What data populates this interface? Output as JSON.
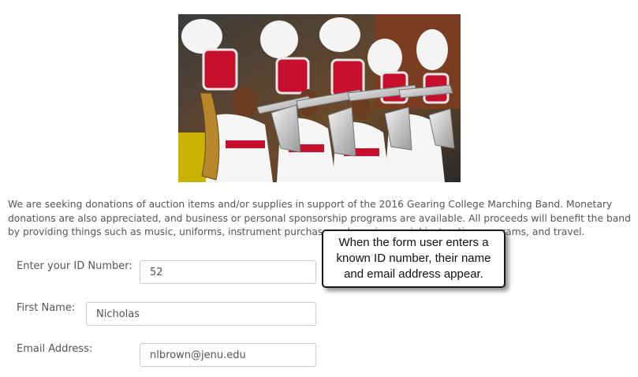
{
  "image": {
    "alt": "Marching band members in red and white uniforms with plumed hats playing trumpets"
  },
  "intro_text": "We are seeking donations of auction items and/or supplies in support of the 2016 Gearing College Marching Band. Monetary donations are also appreciated, and business or personal sponsorship programs are available. All proceeds will benefit the band by providing things such as music, uniforms, instrument purchase and repair, special instruction programs, and travel.",
  "form": {
    "id_label": "Enter your ID Number:",
    "id_value": "52",
    "first_name_label": "First Name:",
    "first_name_value": "Nicholas",
    "email_label": "Email Address:",
    "email_value": "nlbrown@jenu.edu"
  },
  "callout": {
    "text": "When the form user enters a known ID number, their name and email address appear."
  },
  "colors": {
    "text": "#555555",
    "field_border": "#cccccc",
    "callout_border": "#1a1a1a"
  }
}
